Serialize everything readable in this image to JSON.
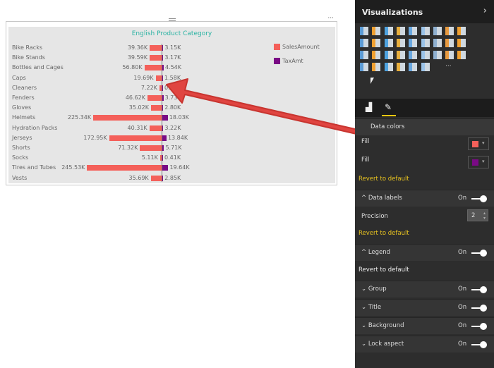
{
  "chart_data": {
    "type": "bar",
    "title": "English Product Category",
    "categories": [
      "Bike Racks",
      "Bike Stands",
      "Bottles and Cages",
      "Caps",
      "Cleaners",
      "Fenders",
      "Gloves",
      "Helmets",
      "Hydration Packs",
      "Jerseys",
      "Shorts",
      "Socks",
      "Tires and Tubes",
      "Vests"
    ],
    "series": [
      {
        "name": "SalesAmount",
        "color": "#f4605a",
        "values": [
          39.36,
          39.59,
          56.8,
          19.69,
          7.22,
          46.62,
          35.02,
          225.34,
          40.31,
          172.95,
          71.32,
          5.11,
          245.53,
          35.69
        ],
        "labels": [
          "39.36K",
          "39.59K",
          "56.80K",
          "19.69K",
          "7.22K",
          "46.62K",
          "35.02K",
          "225.34K",
          "40.31K",
          "172.95K",
          "71.32K",
          "5.11K",
          "245.53K",
          "35.69K"
        ]
      },
      {
        "name": "TaxAmt",
        "color": "#7a0a85",
        "values": [
          3.15,
          3.17,
          4.54,
          1.58,
          0.58,
          3.73,
          2.8,
          18.03,
          3.22,
          13.84,
          5.71,
          0.41,
          19.64,
          2.85
        ],
        "labels": [
          "3.15K",
          "3.17K",
          "4.54K",
          "1.58K",
          "0.58K",
          "3.73K",
          "2.80K",
          "18.03K",
          "3.22K",
          "13.84K",
          "5.71K",
          "0.41K",
          "19.64K",
          "2.85K"
        ]
      }
    ],
    "legend": "top-right"
  },
  "card": {
    "more": "···"
  },
  "panel": {
    "title": "Visualizations",
    "chevron": "›",
    "more_visuals": "···",
    "data_colors": "Data colors",
    "fill1": "Fill",
    "fill2": "Fill",
    "revert": "Revert to default",
    "data_labels": "Data labels",
    "precision_label": "Precision",
    "precision_value": "2",
    "legend": "Legend",
    "group": "Group",
    "title_sec": "Title",
    "background": "Background",
    "lock_aspect": "Lock aspect",
    "on": "On"
  }
}
